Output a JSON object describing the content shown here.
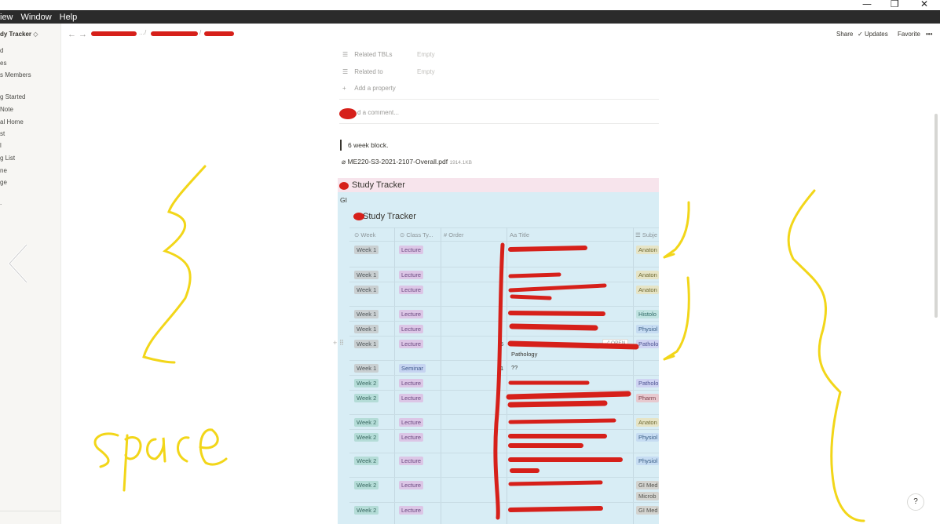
{
  "menubar": {
    "items": [
      "View",
      "Window",
      "Help"
    ],
    "visible_items": [
      "iew",
      "Window",
      "Help"
    ]
  },
  "window_controls": {
    "minimize": "—",
    "restore": "❐",
    "close": "✕"
  },
  "sidebar": {
    "workspace_title": "dy Tracker",
    "items": [
      "d",
      "es",
      "s Members",
      "g Started",
      "Note",
      "al Home",
      "st",
      "l",
      "g List",
      "ne",
      "ge",
      "."
    ]
  },
  "topbar": {
    "share": "Share",
    "updates": "Updates",
    "favorite": "Favorite",
    "more": "•••",
    "ellipsis": "...",
    "sep": "/"
  },
  "properties": [
    {
      "label": "Related TBLs",
      "value": "Empty"
    },
    {
      "label": "Related to",
      "value": "Empty"
    }
  ],
  "add_property": "Add a property",
  "comment_placeholder": "d a comment...",
  "quote_text": "6 week block.",
  "attachment": {
    "name": "ME220-S3-2021-2107-Overall.pdf",
    "size": "1914.1KB"
  },
  "callout_title": "Study Tracker",
  "gi_label": "GI",
  "database": {
    "title": "Study Tracker",
    "columns": [
      "Week",
      "Class Ty...",
      "Order",
      "Title",
      "Subje"
    ],
    "open_button": "OPEN",
    "rows": [
      {
        "week": "Week 1",
        "type": "Lecture",
        "order": "",
        "title": "",
        "subject": "Anaton"
      },
      {
        "week": "Week 1",
        "type": "Lecture",
        "order": "",
        "title": "",
        "subject": "Anaton"
      },
      {
        "week": "Week 1",
        "type": "Lecture",
        "order": "",
        "title": "",
        "subject": "Anaton"
      },
      {
        "week": "Week 1",
        "type": "Lecture",
        "order": "",
        "title": "",
        "subject": "Histolo"
      },
      {
        "week": "Week 1",
        "type": "Lecture",
        "order": "",
        "title": "",
        "subject": "Physiol"
      },
      {
        "week": "Week 1",
        "type": "Lecture",
        "order": "6",
        "title": "Pathology",
        "subject": "Patholo"
      },
      {
        "week": "Week 1",
        "type": "Seminar",
        "order": "1",
        "title": "??",
        "subject": ""
      },
      {
        "week": "Week 2",
        "type": "Lecture",
        "order": "",
        "title": "",
        "subject": "Patholo"
      },
      {
        "week": "Week 2",
        "type": "Lecture",
        "order": "",
        "title": "",
        "subject": "Pharm"
      },
      {
        "week": "Week 2",
        "type": "Lecture",
        "order": "",
        "title": "",
        "subject": "Anaton"
      },
      {
        "week": "Week 2",
        "type": "Lecture",
        "order": "",
        "title": "",
        "subject": "Physiol"
      },
      {
        "week": "Week 2",
        "type": "Lecture",
        "order": "",
        "title": "",
        "subject": "Physiol"
      },
      {
        "week": "Week 2",
        "type": "Lecture",
        "order": "",
        "title": "",
        "subject": "GI Med"
      },
      {
        "week": "Week 2",
        "type": "Lecture",
        "order": "",
        "title": "",
        "subject": "GI Med"
      }
    ],
    "extra_subjects": [
      "Microb"
    ]
  },
  "annotation_text": "space",
  "help": "?",
  "colors": {
    "annotation_yellow": "#f2d619",
    "redaction_red": "#d6201a",
    "callout_pink": "#f7e4ec",
    "gi_blue": "#d8edf5"
  }
}
